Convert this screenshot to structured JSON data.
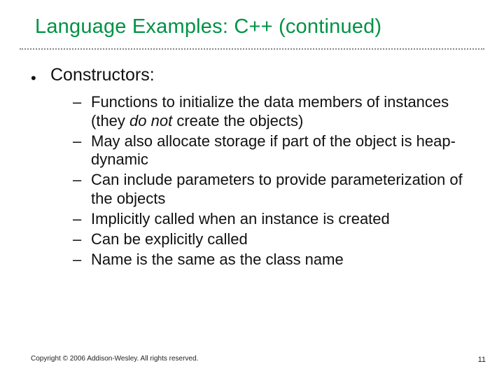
{
  "title": "Language Examples: C++ (continued)",
  "section": {
    "heading": "Constructors:",
    "bullets": [
      {
        "pre": "Functions to initialize the data members of instances (they ",
        "em": "do not",
        "post": " create the objects)"
      },
      {
        "pre": "May also allocate storage if part of the object is heap-dynamic",
        "em": "",
        "post": ""
      },
      {
        "pre": "Can include parameters to provide parameterization of the objects",
        "em": "",
        "post": ""
      },
      {
        "pre": "Implicitly called when an instance is created",
        "em": "",
        "post": ""
      },
      {
        "pre": "Can be explicitly called",
        "em": "",
        "post": ""
      },
      {
        "pre": "Name is the same as the class name",
        "em": "",
        "post": ""
      }
    ]
  },
  "footer": "Copyright © 2006 Addison-Wesley. All rights reserved.",
  "page_number": "11"
}
